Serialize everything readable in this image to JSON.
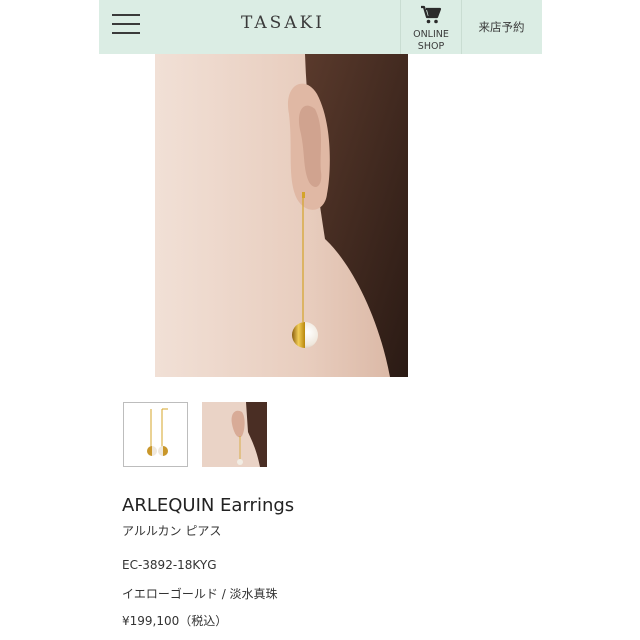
{
  "header": {
    "logo": "TASAKI",
    "online_shop_line1": "ONLINE",
    "online_shop_line2": "SHOP",
    "reserve_label": "来店予約"
  },
  "product": {
    "name": "ARLEQUIN Earrings",
    "name_ja": "アルルカン ピアス",
    "code": "EC-3892-18KYG",
    "material": "イエローゴールド / 淡水真珠",
    "price": "¥199,100（税込）"
  },
  "colors": {
    "header_bg": "#dbede4",
    "gold": "#d4a42a",
    "pearl": "#f2ede4",
    "skin": "#e8cfc0"
  }
}
